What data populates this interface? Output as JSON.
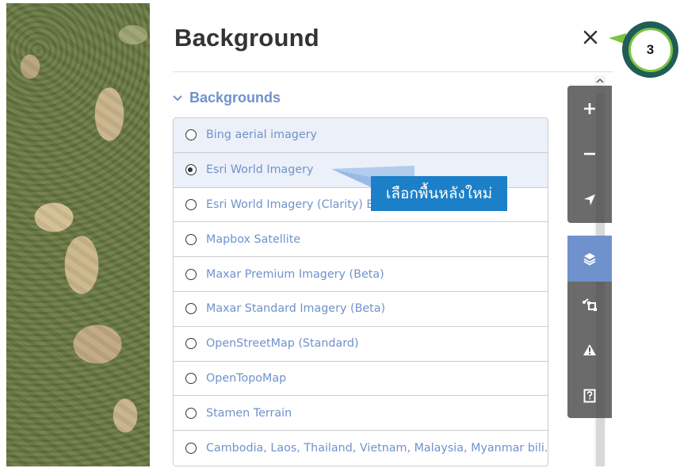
{
  "panel": {
    "title": "Background",
    "close_icon": "close-icon"
  },
  "section": {
    "label": "Backgrounds",
    "icon": "chevron-down-icon"
  },
  "backgrounds": [
    {
      "label": "Bing aerial imagery",
      "selected": false
    },
    {
      "label": "Esri World Imagery",
      "selected": true
    },
    {
      "label": "Esri World Imagery (Clarity) Beta",
      "selected": false
    },
    {
      "label": "Mapbox Satellite",
      "selected": false
    },
    {
      "label": "Maxar Premium Imagery (Beta)",
      "selected": false
    },
    {
      "label": "Maxar Standard Imagery (Beta)",
      "selected": false
    },
    {
      "label": "OpenStreetMap (Standard)",
      "selected": false
    },
    {
      "label": "OpenTopoMap",
      "selected": false
    },
    {
      "label": "Stamen Terrain",
      "selected": false
    },
    {
      "label": "Cambodia, Laos, Thailand, Vietnam, Malaysia, Myanmar bili...",
      "selected": false
    }
  ],
  "map_controls": {
    "zoom_group": [
      "zoom-in-icon",
      "zoom-out-icon",
      "geolocate-icon"
    ],
    "panel_group": [
      "layers-icon",
      "map-data-icon",
      "issues-icon",
      "help-icon"
    ],
    "active": "layers-icon"
  },
  "annotation": {
    "callout_text": "เลือกพื้นหลังใหม่",
    "step_number": "3"
  },
  "colors": {
    "accent": "#7092cc",
    "callout": "#1c80c8",
    "badge_ring": "#7dc242",
    "badge_outer": "#1f5d56"
  }
}
